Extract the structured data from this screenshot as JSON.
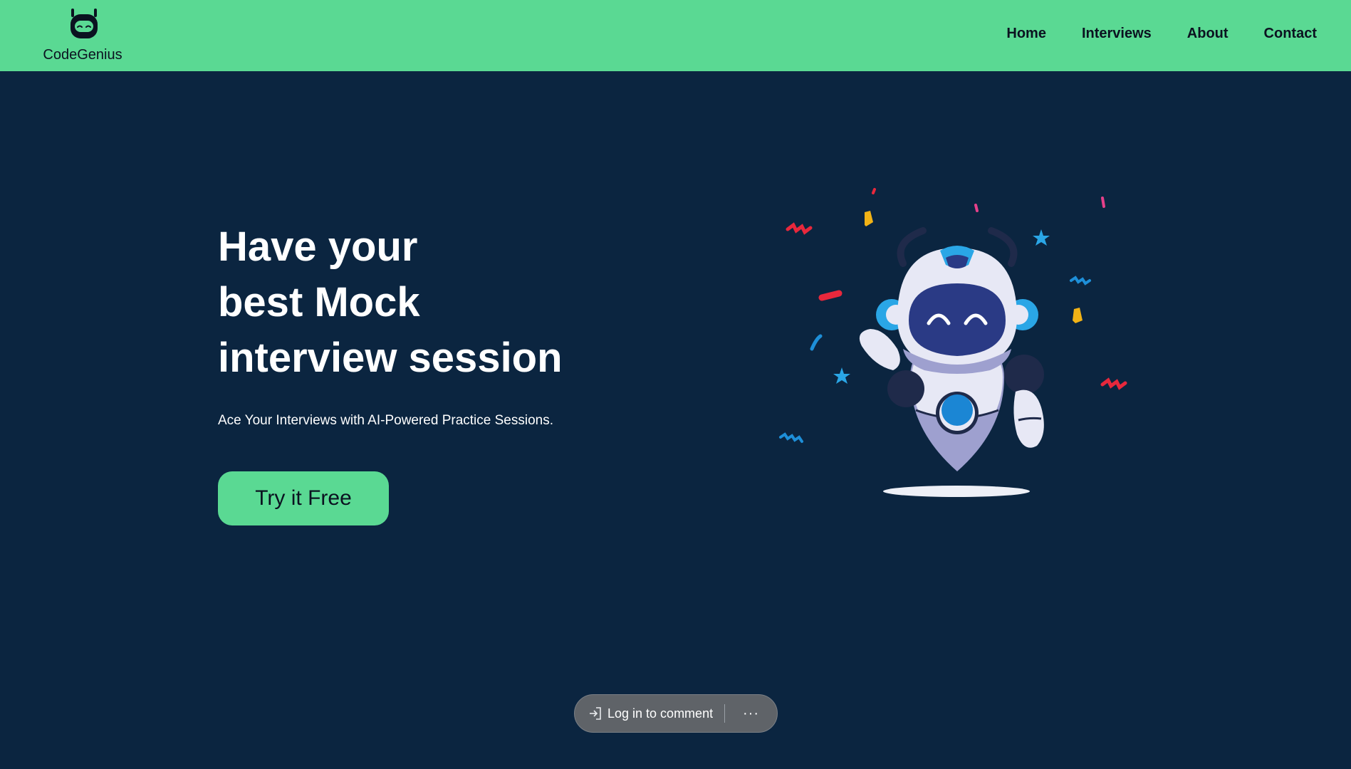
{
  "brand": {
    "name": "CodeGenius"
  },
  "nav": {
    "items": [
      {
        "label": "Home"
      },
      {
        "label": "Interviews"
      },
      {
        "label": "About"
      },
      {
        "label": "Contact"
      }
    ]
  },
  "hero": {
    "title_lines": [
      "Have your",
      "best Mock",
      "interview session"
    ],
    "subtitle": "Ace Your Interviews with AI-Powered Practice Sessions.",
    "cta_label": "Try it Free"
  },
  "comment_bar": {
    "login_label": "Log in to comment",
    "more_label": "···"
  },
  "colors": {
    "header_bg": "#5ad993",
    "page_bg": "#0b2540",
    "accent": "#5ad993",
    "text_dark": "#0b1220",
    "text_light": "#ffffff"
  },
  "icons": {
    "brand": "robot-head-icon",
    "login": "sign-in-arrow-icon",
    "more": "ellipsis-icon"
  }
}
